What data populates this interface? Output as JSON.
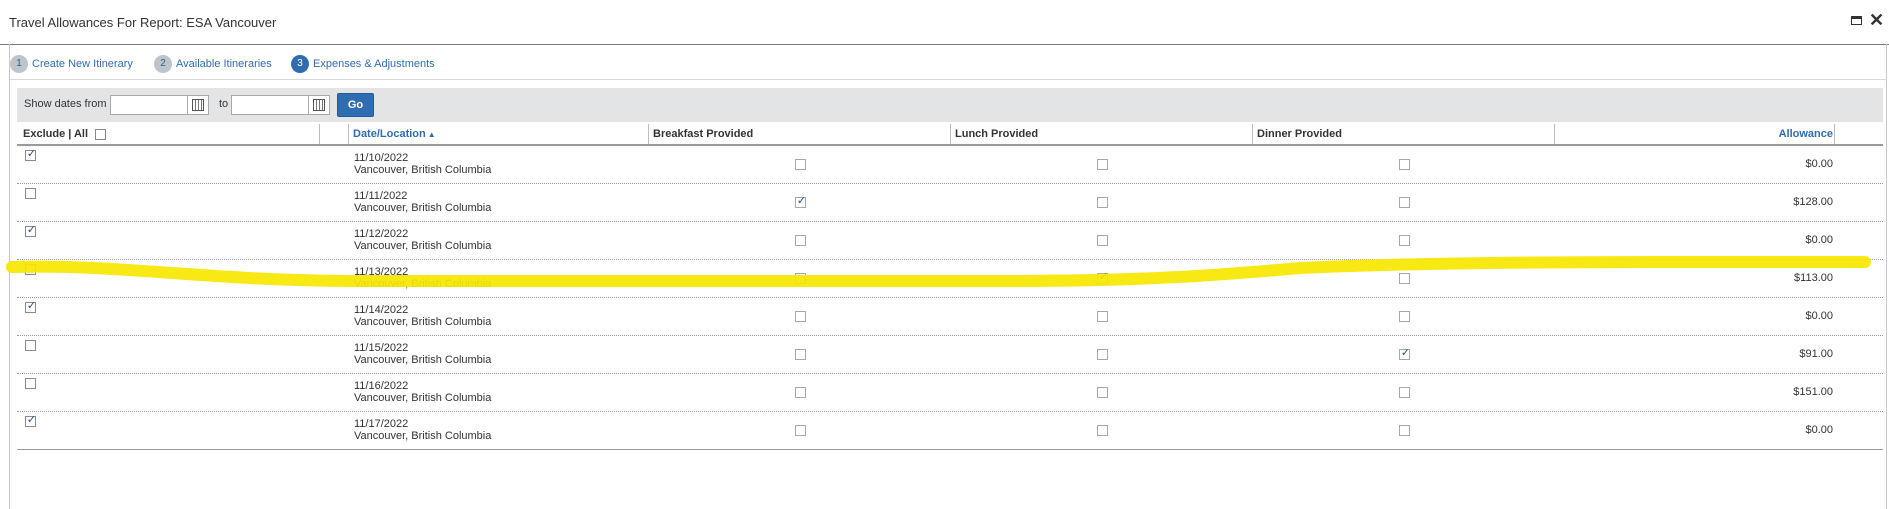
{
  "window": {
    "title": "Travel Allowances For Report: ESA Vancouver",
    "maximize_icon": "maximize-icon",
    "close_glyph": "✕"
  },
  "steps": [
    {
      "number": "1",
      "label": "Create New Itinerary",
      "active": false
    },
    {
      "number": "2",
      "label": "Available Itineraries",
      "active": false
    },
    {
      "number": "3",
      "label": "Expenses & Adjustments",
      "active": true
    }
  ],
  "filter": {
    "show_dates_from_label": "Show dates from",
    "to_label": "to",
    "from_value": "",
    "to_value": "",
    "go_label": "Go",
    "calendar_icon": "calendar-icon"
  },
  "table": {
    "headers": {
      "exclude_all": "Exclude | All",
      "date_location": "Date/Location",
      "sort_indicator": "▲",
      "breakfast": "Breakfast Provided",
      "lunch": "Lunch Provided",
      "dinner": "Dinner Provided",
      "allowance": "Allowance"
    },
    "rows": [
      {
        "exclude": true,
        "date": "11/10/2022",
        "location": "Vancouver, British Columbia",
        "breakfast": false,
        "lunch": false,
        "dinner": false,
        "allowance": "$0.00"
      },
      {
        "exclude": false,
        "date": "11/11/2022",
        "location": "Vancouver, British Columbia",
        "breakfast": true,
        "lunch": false,
        "dinner": false,
        "allowance": "$128.00"
      },
      {
        "exclude": true,
        "date": "11/12/2022",
        "location": "Vancouver, British Columbia",
        "breakfast": false,
        "lunch": false,
        "dinner": false,
        "allowance": "$0.00"
      },
      {
        "exclude": false,
        "date": "11/13/2022",
        "location": "Vancouver, British Columbia",
        "breakfast": false,
        "lunch": true,
        "dinner": false,
        "allowance": "$113.00"
      },
      {
        "exclude": true,
        "date": "11/14/2022",
        "location": "Vancouver, British Columbia",
        "breakfast": false,
        "lunch": false,
        "dinner": false,
        "allowance": "$0.00"
      },
      {
        "exclude": false,
        "date": "11/15/2022",
        "location": "Vancouver, British Columbia",
        "breakfast": false,
        "lunch": false,
        "dinner": true,
        "allowance": "$91.00"
      },
      {
        "exclude": false,
        "date": "11/16/2022",
        "location": "Vancouver, British Columbia",
        "breakfast": false,
        "lunch": false,
        "dinner": false,
        "allowance": "$151.00"
      },
      {
        "exclude": true,
        "date": "11/17/2022",
        "location": "Vancouver, British Columbia",
        "breakfast": false,
        "lunch": false,
        "dinner": false,
        "allowance": "$0.00"
      }
    ]
  },
  "annotation": {
    "highlight_color": "#f7e600",
    "highlighted_row_date": "11/13/2022"
  },
  "colors": {
    "accent": "#2f6db3",
    "filter_bar": "#e2e4e6",
    "check": "#244f8c"
  }
}
